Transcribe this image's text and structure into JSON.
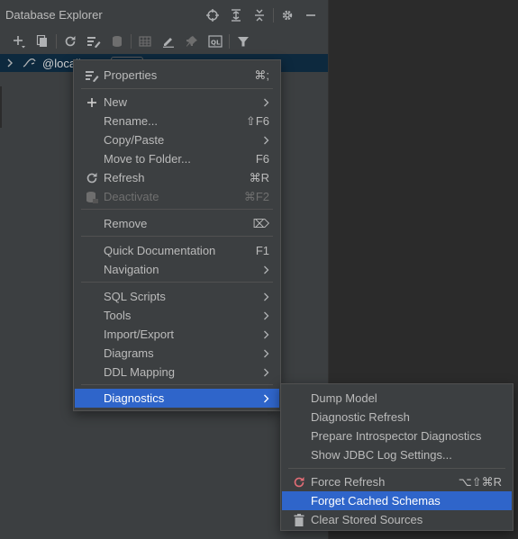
{
  "panel": {
    "title": "Database Explorer"
  },
  "title_icons": [
    "crosshair-icon",
    "expand-all-icon",
    "collapse-all-icon",
    "gear-icon",
    "minimize-icon"
  ],
  "toolbar_icons": [
    "add-icon",
    "copy-icon",
    "refresh-icon",
    "data-source-properties-icon",
    "deactivate-icon",
    "table-icon",
    "edit-icon",
    "pin-icon",
    "console-icon",
    "filter-icon"
  ],
  "tree": {
    "root_label": "@locall"
  },
  "context_menu": {
    "items": [
      {
        "label": "Properties",
        "shortcut": "⌘;",
        "icon": "properties-icon"
      },
      {
        "label": "New",
        "submenu": true,
        "icon": "plus-icon"
      },
      {
        "label": "Rename...",
        "shortcut": "⇧F6"
      },
      {
        "label": "Copy/Paste",
        "submenu": true
      },
      {
        "label": "Move to Folder...",
        "shortcut": "F6"
      },
      {
        "label": "Refresh",
        "shortcut": "⌘R",
        "icon": "refresh-icon"
      },
      {
        "label": "Deactivate",
        "shortcut": "⌘F2",
        "icon": "deactivate-icon",
        "disabled": true
      },
      {
        "label": "Remove",
        "shortcut": "⌦"
      },
      {
        "label": "Quick Documentation",
        "shortcut": "F1"
      },
      {
        "label": "Navigation",
        "submenu": true
      },
      {
        "label": "SQL Scripts",
        "submenu": true
      },
      {
        "label": "Tools",
        "submenu": true
      },
      {
        "label": "Import/Export",
        "submenu": true
      },
      {
        "label": "Diagrams",
        "submenu": true
      },
      {
        "label": "DDL Mapping",
        "submenu": true
      },
      {
        "label": "Diagnostics",
        "submenu": true,
        "selected": true
      }
    ]
  },
  "diagnostics_submenu": {
    "items": [
      {
        "label": "Dump Model"
      },
      {
        "label": "Diagnostic Refresh"
      },
      {
        "label": "Prepare Introspector Diagnostics"
      },
      {
        "label": "Show JDBC Log Settings..."
      },
      {
        "label": "Force Refresh",
        "shortcut": "⌥⇧⌘R",
        "icon": "force-refresh-icon"
      },
      {
        "label": "Forget Cached Schemas",
        "selected": true
      },
      {
        "label": "Clear Stored Sources",
        "icon": "trash-icon"
      }
    ]
  },
  "colors": {
    "panel_bg": "#3c3f41",
    "editor_bg": "#2b2b2b",
    "selection": "#2f65ca",
    "tree_selection": "#0d293e"
  }
}
